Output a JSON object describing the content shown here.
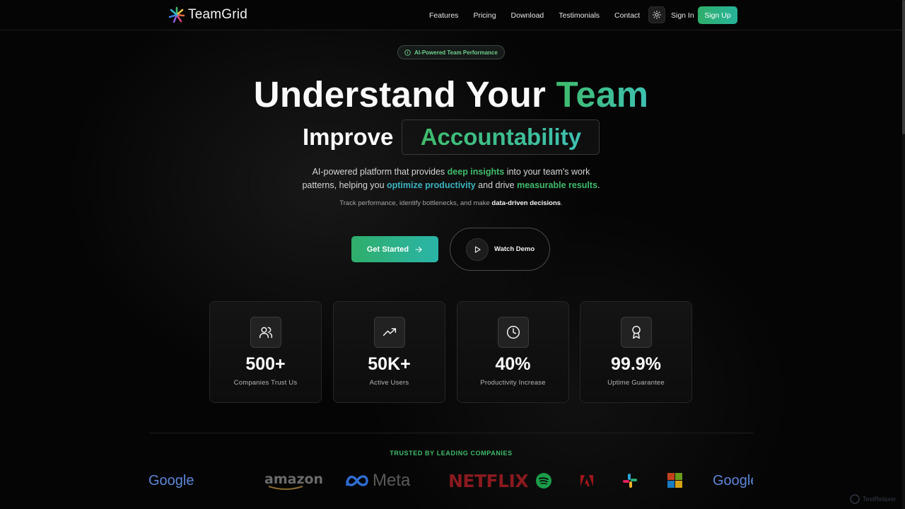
{
  "app": {
    "name": "TeamGrid"
  },
  "nav": {
    "links": [
      "Features",
      "Pricing",
      "Download",
      "Testimonials",
      "Contact"
    ],
    "theme_icon": "sun-icon",
    "signin_label": "Sign In",
    "signup_label": "Sign Up"
  },
  "hero": {
    "badge": "AI-Powered Team Performance",
    "headline_main": "Understand Your ",
    "headline_accent": "Team",
    "improve_label": "Improve",
    "rotating_word": "Accountability",
    "desc": {
      "p1": "AI-powered platform that provides ",
      "h1": "deep insights",
      "p2": " into your team's work",
      "p3": "patterns, helping you ",
      "h2": "optimize productivity",
      "p4": " and drive ",
      "h3": "measurable results",
      "p5": "."
    },
    "subdesc": {
      "text": "Track performance, identify bottlenecks, and make ",
      "bold": "data-driven decisions",
      "end": "."
    },
    "cta_label": "Get Started",
    "demo_label": "Watch Demo"
  },
  "stats": [
    {
      "icon": "users-icon",
      "value": "500+",
      "label": "Companies Trust Us"
    },
    {
      "icon": "trending-up-icon",
      "value": "50K+",
      "label": "Active Users"
    },
    {
      "icon": "clock-icon",
      "value": "40%",
      "label": "Productivity Increase"
    },
    {
      "icon": "award-icon",
      "value": "99.9%",
      "label": "Uptime Guarantee"
    }
  ],
  "trusted": {
    "heading": "TRUSTED BY LEADING COMPANIES",
    "brands": [
      "Google",
      "amazon",
      "Meta",
      "NETFLIX",
      "Spotify",
      "Adobe",
      "Slack",
      "Microsoft",
      "Google"
    ]
  },
  "watermark": "TestRelaxer",
  "colors": {
    "accent_green": "#3fbb6b",
    "accent_teal": "#3ab4c0",
    "background": "#050505"
  }
}
